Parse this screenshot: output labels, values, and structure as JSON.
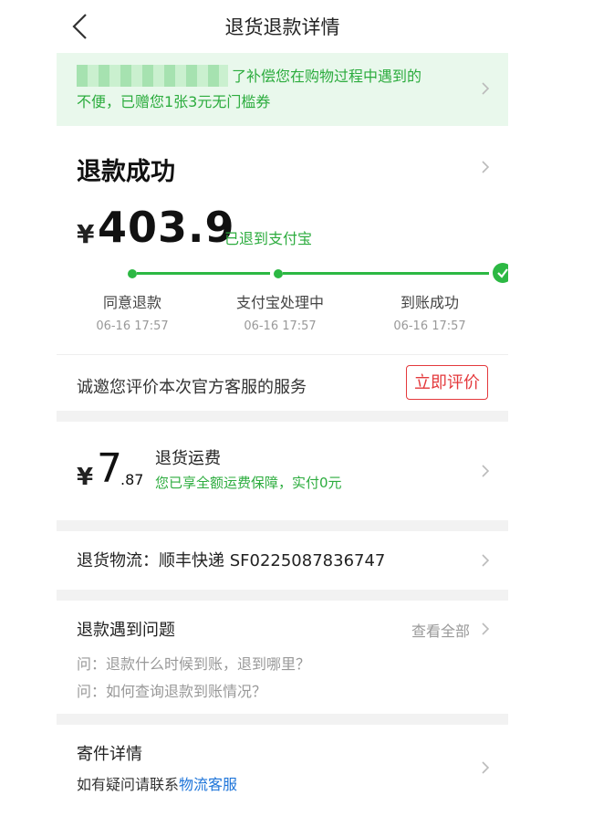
{
  "header": {
    "title": "退货退款详情"
  },
  "banner": {
    "text_line1": "了补偿您在购物过程中遇到的",
    "text_line2": "不便，已赠您1张3元无门槛券"
  },
  "status": {
    "title": "退款成功",
    "currency": "¥",
    "amount": "403.9",
    "refund_destination": "已退到支付宝",
    "steps": [
      {
        "label": "同意退款",
        "time": "06-16 17:57"
      },
      {
        "label": "支付宝处理中",
        "time": "06-16 17:57"
      },
      {
        "label": "到账成功",
        "time": "06-16 17:57"
      }
    ],
    "invite_text": "诚邀您评价本次官方客服的服务",
    "rate_button": "立即评价"
  },
  "shipping_fee": {
    "currency": "¥",
    "integer": "7",
    "decimal": ".87",
    "title": "退货运费",
    "note": "您已享全额运费保障，实付0元"
  },
  "logistics": {
    "text": "退货物流：顺丰快递 SF0225087836747"
  },
  "questions": {
    "title": "退款遇到问题",
    "view_all": "查看全部",
    "items": [
      "问：退款什么时候到账，退到哪里？",
      "问：如何查询退款到账情况？"
    ]
  },
  "mail_details": {
    "title": "寄件详情",
    "prefix": "如有疑问请联系",
    "link": "物流客服"
  },
  "colors": {
    "accent_green": "#2cb843",
    "accent_red": "#e4393c",
    "link_blue": "#1d74d9"
  }
}
